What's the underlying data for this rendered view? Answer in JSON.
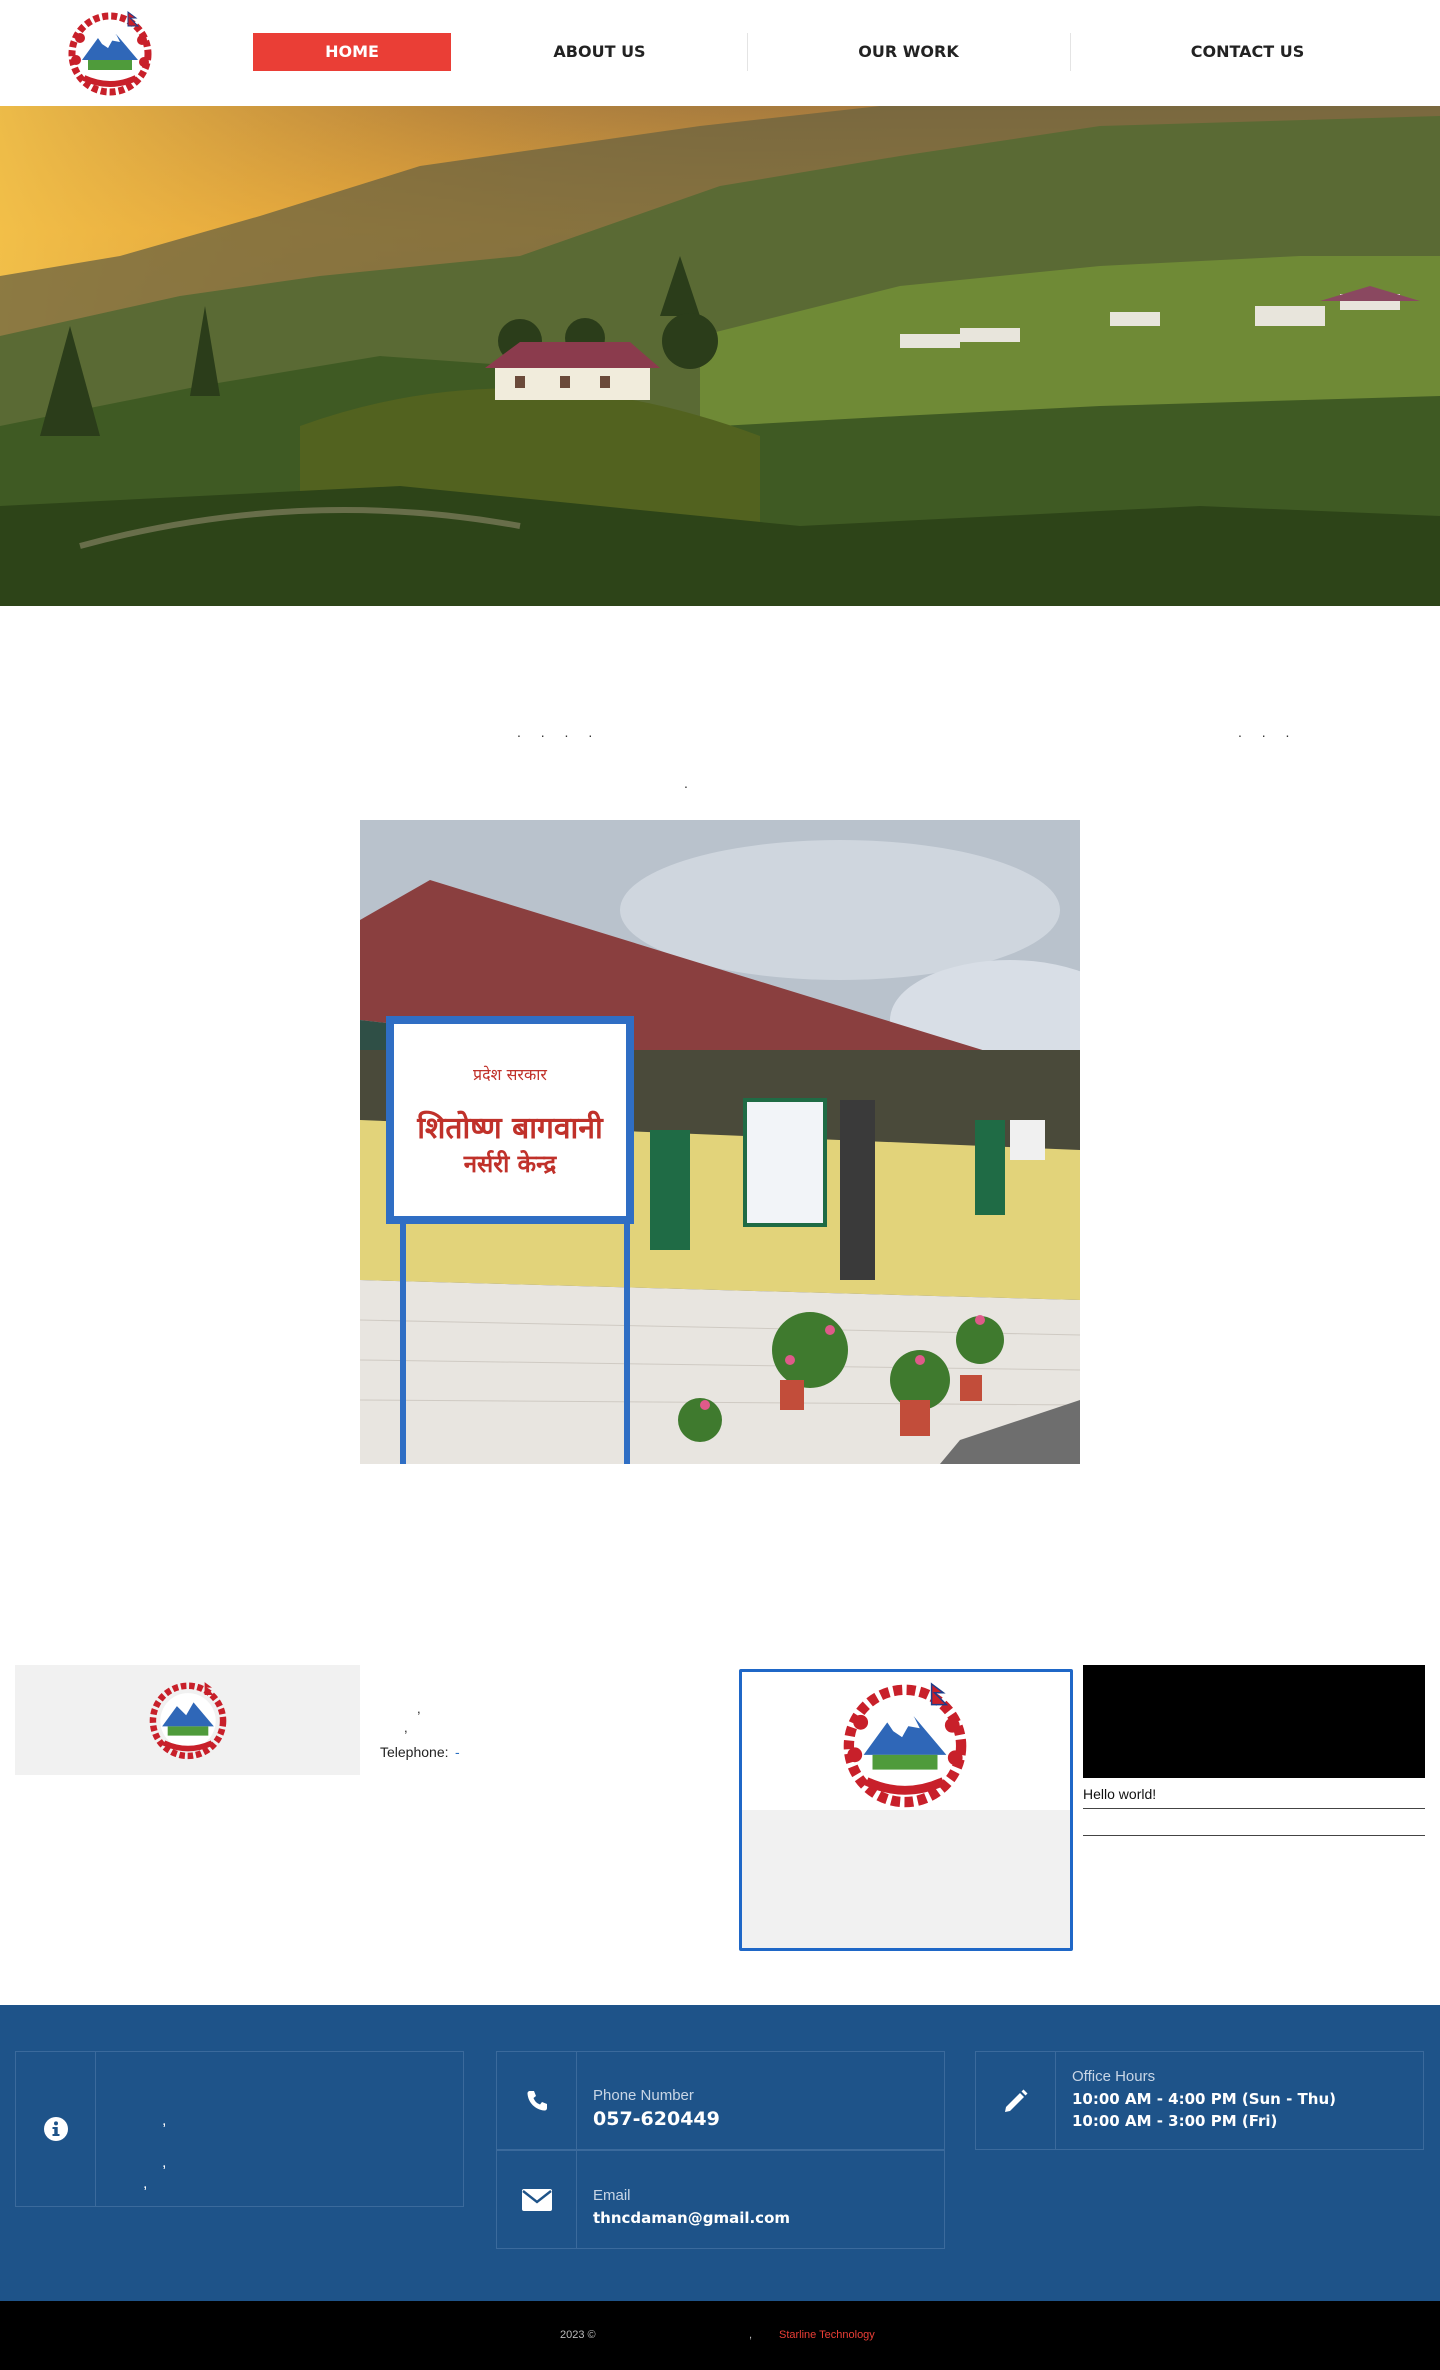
{
  "nav": {
    "items": [
      {
        "label": "HOME",
        "active": true
      },
      {
        "label": "ABOUT US",
        "active": false
      },
      {
        "label": "OUR WORK",
        "active": false
      },
      {
        "label": "CONTACT US",
        "active": false
      }
    ]
  },
  "intro": {
    "dots_left": ". . .   .",
    "dots_right": ". . .",
    "dot_center": "."
  },
  "info": {
    "comma1": ",",
    "comma2": ",",
    "telephone_label": "Telephone:",
    "telephone_value": "-"
  },
  "widget": {
    "hello_text": "Hello world!"
  },
  "footer": {
    "address_commas": [
      ",",
      ",",
      ","
    ],
    "phone_label": "Phone Number",
    "phone_value": "057-620449",
    "email_label": "Email",
    "email_value": "thncdaman@gmail.com",
    "hours_label": "Office Hours",
    "hours_line1": "10:00 AM - 4:00 PM (Sun - Thu)",
    "hours_line2": "10:00 AM - 3:00 PM (Fri)"
  },
  "bottom": {
    "copyright": "2023 ©",
    "separator": ",",
    "credit": "Starline Technology"
  },
  "colors": {
    "accent_red": "#ea3e36",
    "footer_blue": "#1e5389",
    "card_border_blue": "#1f67c7"
  }
}
